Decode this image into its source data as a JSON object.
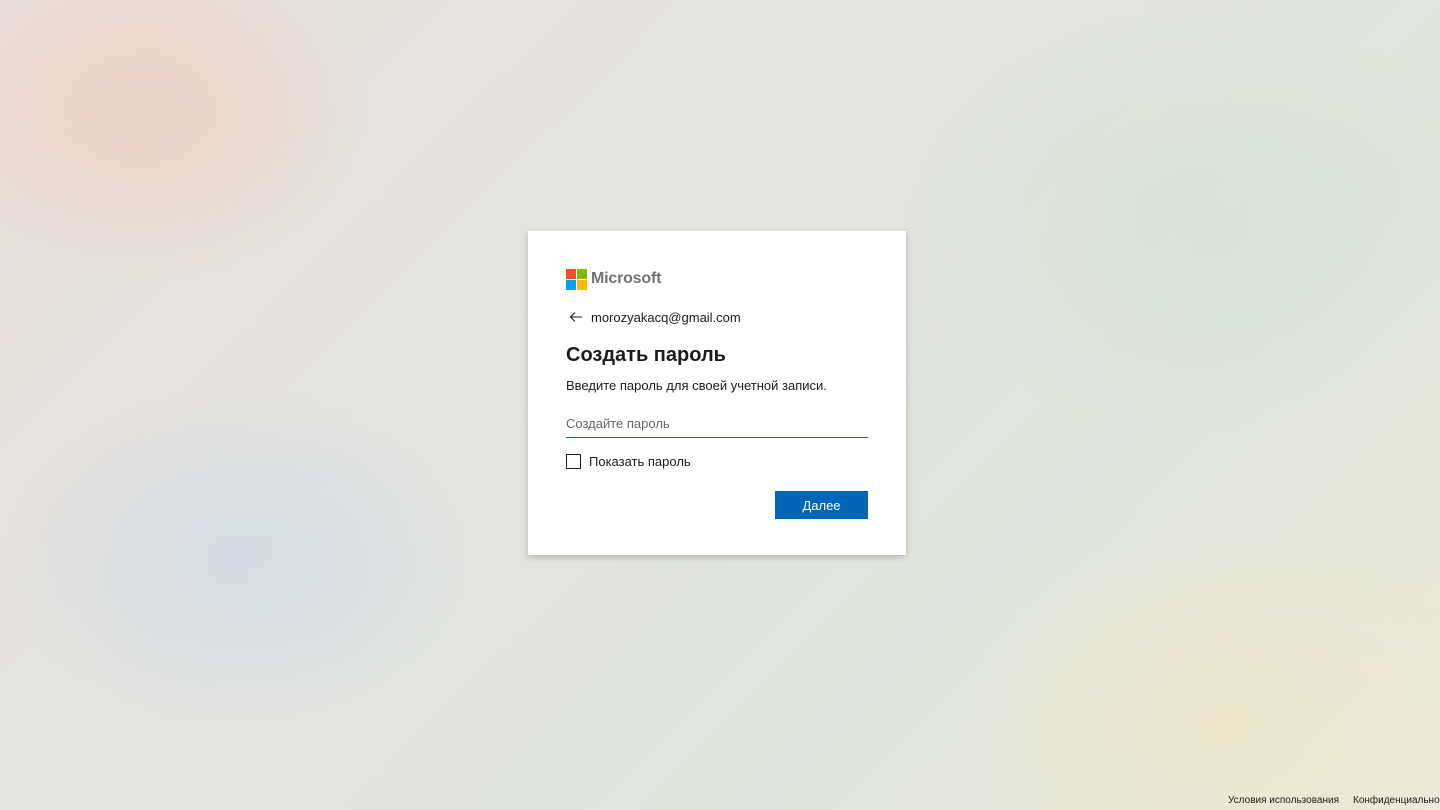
{
  "colors": {
    "accent": "#0067b8",
    "logo_red": "#f25022",
    "logo_green": "#7fba00",
    "logo_blue": "#00a4ef",
    "logo_yellow": "#ffb900"
  },
  "brand": {
    "name": "Microsoft",
    "logo_icon": "microsoft-logo-icon"
  },
  "identity": {
    "email": "morozyakacq@gmail.com",
    "back_icon": "back-arrow-icon"
  },
  "form": {
    "title": "Создать пароль",
    "description": "Введите пароль для своей учетной записи.",
    "password_value": "",
    "password_placeholder": "Создайте пароль",
    "show_password_label": "Показать пароль",
    "show_password_checked": false,
    "next_label": "Далее"
  },
  "footer": {
    "links": [
      "Условия использования",
      "Конфиденциально"
    ]
  }
}
